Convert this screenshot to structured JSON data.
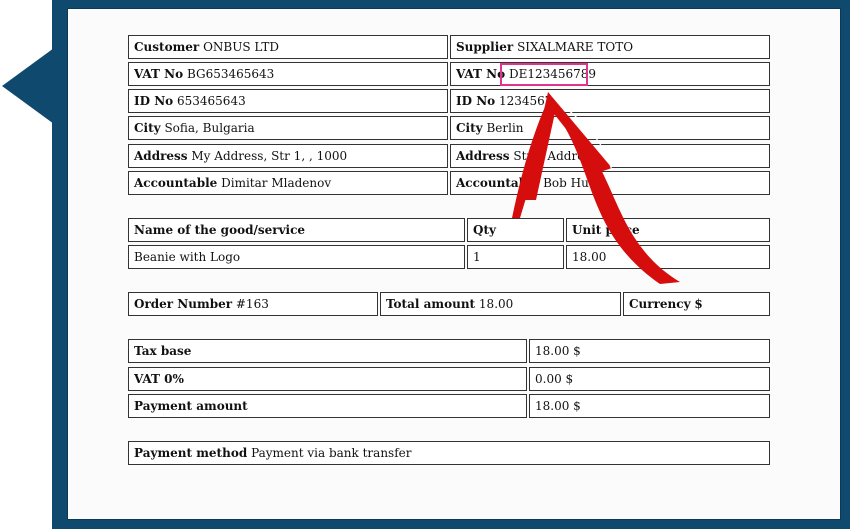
{
  "parties": {
    "customer_label": "Customer",
    "customer_value": "ONBUS LTD",
    "supplier_label": "Supplier",
    "supplier_value": "SIXALMARE TOTO",
    "vat_label": "VAT No",
    "customer_vat": "BG653465643",
    "supplier_vat": "DE123456789",
    "id_label": "ID No",
    "customer_id": "653465643",
    "supplier_id": "1234567",
    "city_label": "City",
    "customer_city": "Sofia, Bulgaria",
    "supplier_city": "Berlin",
    "address_label": "Address",
    "customer_address": "My Address, Str 1, , 1000",
    "supplier_address": "Str 1 Address",
    "accountable_label": "Accountable",
    "customer_accountable": "Dimitar Mladenov",
    "supplier_accountable": "Bob Hu"
  },
  "goods": {
    "headers": [
      "Name of the good/service",
      "Qty",
      "Unit price"
    ],
    "rows": [
      [
        "Beanie with Logo",
        "1",
        "18.00"
      ]
    ]
  },
  "order": {
    "number_label": "Order Number",
    "number_value": "#163",
    "total_label": "Total amount",
    "total_value": "18.00",
    "currency_label": "Currency",
    "currency_value": "$"
  },
  "totals": [
    {
      "label": "Tax base",
      "value": "18.00 $"
    },
    {
      "label": "VAT 0%",
      "value": "0.00 $"
    },
    {
      "label": "Payment amount",
      "value": "18.00 $"
    }
  ],
  "payment": {
    "label": "Payment method",
    "value": "Payment via bank transfer"
  },
  "colors": {
    "frame": "#0f4a6e",
    "highlight": "#e0358e",
    "arrow": "#d60d0d"
  }
}
